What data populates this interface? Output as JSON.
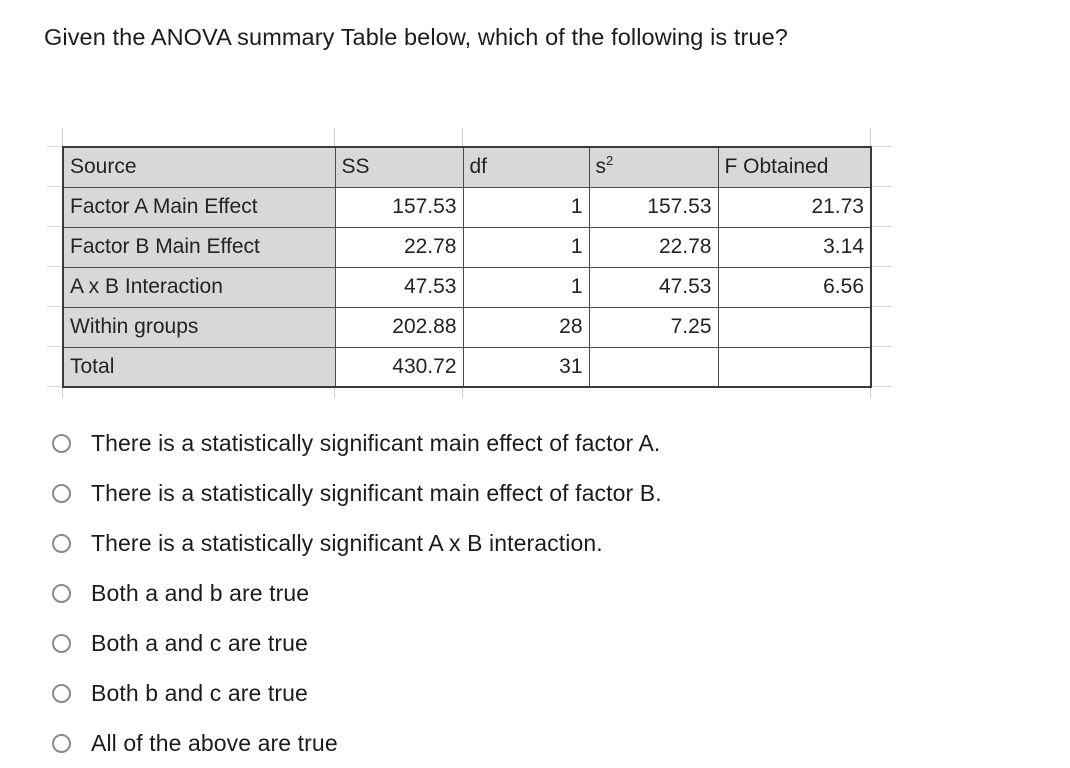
{
  "question": {
    "prompt": "Given the ANOVA summary Table below, which of the following is true?"
  },
  "table": {
    "headers": [
      "Source",
      "SS",
      "df",
      "s",
      "F Obtained"
    ],
    "header_s_superscript": "2",
    "rows": [
      {
        "source": "Factor A Main Effect",
        "ss": "157.53",
        "df": "1",
        "s2": "157.53",
        "f_obtained": "21.73"
      },
      {
        "source": "Factor B Main Effect",
        "ss": "22.78",
        "df": "1",
        "s2": "22.78",
        "f_obtained": "3.14"
      },
      {
        "source": "A x B Interaction",
        "ss": "47.53",
        "df": "1",
        "s2": "47.53",
        "f_obtained": "6.56"
      },
      {
        "source": "Within groups",
        "ss": "202.88",
        "df": "28",
        "s2": "7.25",
        "f_obtained": ""
      },
      {
        "source": "Total",
        "ss": "430.72",
        "df": "31",
        "s2": "",
        "f_obtained": ""
      }
    ]
  },
  "options": [
    {
      "label": "There is a statistically significant main effect of factor A."
    },
    {
      "label": "There is a statistically significant main effect of factor B."
    },
    {
      "label": "There is a statistically significant A x B interaction."
    },
    {
      "label": "Both a and b are true"
    },
    {
      "label": "Both a and c are true"
    },
    {
      "label": "Both b and c are true"
    },
    {
      "label": "All of the above are true"
    }
  ],
  "colors": {
    "header_fill": "#d8d8d8",
    "label_fill": "#d8d8d8",
    "cell_fill": "#ffffff",
    "border": "#4a4a4a",
    "gridline": "#d9d9d9",
    "text": "#1c1c1c",
    "radio_border": "#8a8a8a"
  }
}
